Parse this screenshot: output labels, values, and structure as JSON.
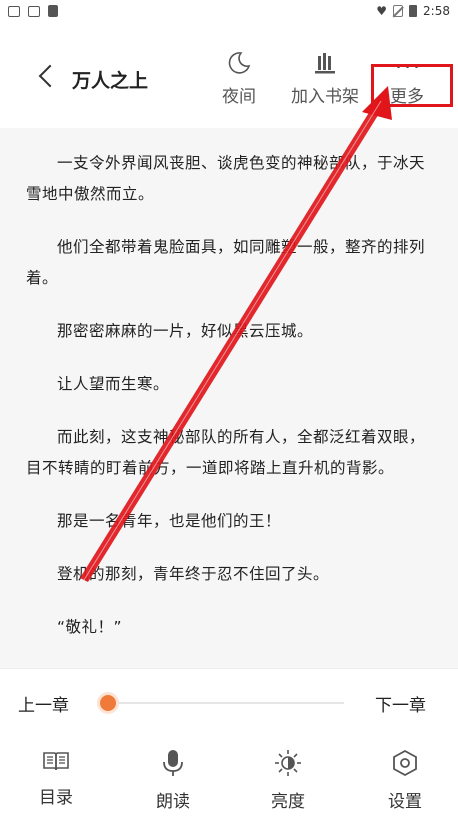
{
  "status_bar": {
    "time": "2:58"
  },
  "header": {
    "title": "万人之上",
    "actions": [
      {
        "label": "夜间",
        "icon": "moon-icon"
      },
      {
        "label": "加入书架",
        "icon": "bookshelf-icon"
      },
      {
        "label": "更多",
        "icon": "more-dots-icon"
      }
    ]
  },
  "content": {
    "paragraphs": [
      "一支令外界闻风丧胆、谈虎色变的神秘部队，于冰天雪地中傲然而立。",
      "他们全都带着鬼脸面具，如同雕塑一般，整齐的排列着。",
      "那密密麻麻的一片，好似黑云压城。",
      "让人望而生寒。",
      "而此刻，这支神秘部队的所有人，全都泛红着双眼，目不转睛的盯着前方，一道即将踏上直升机的背影。",
      "那是一名青年，也是他们的王！",
      "登机的那刻，青年终于忍不住回了头。",
      "“敬礼！”"
    ]
  },
  "bottom": {
    "prev_chapter": "上一章",
    "next_chapter": "下一章",
    "progress": 0.0,
    "tools": [
      {
        "label": "目录",
        "icon": "catalog-book-icon"
      },
      {
        "label": "朗读",
        "icon": "microphone-icon"
      },
      {
        "label": "亮度",
        "icon": "brightness-icon"
      },
      {
        "label": "设置",
        "icon": "settings-hexagon-icon"
      }
    ]
  },
  "colors": {
    "accent": "#f07a3a",
    "annotation_red": "#e0161a",
    "reading_bg": "#f6f6f6"
  }
}
